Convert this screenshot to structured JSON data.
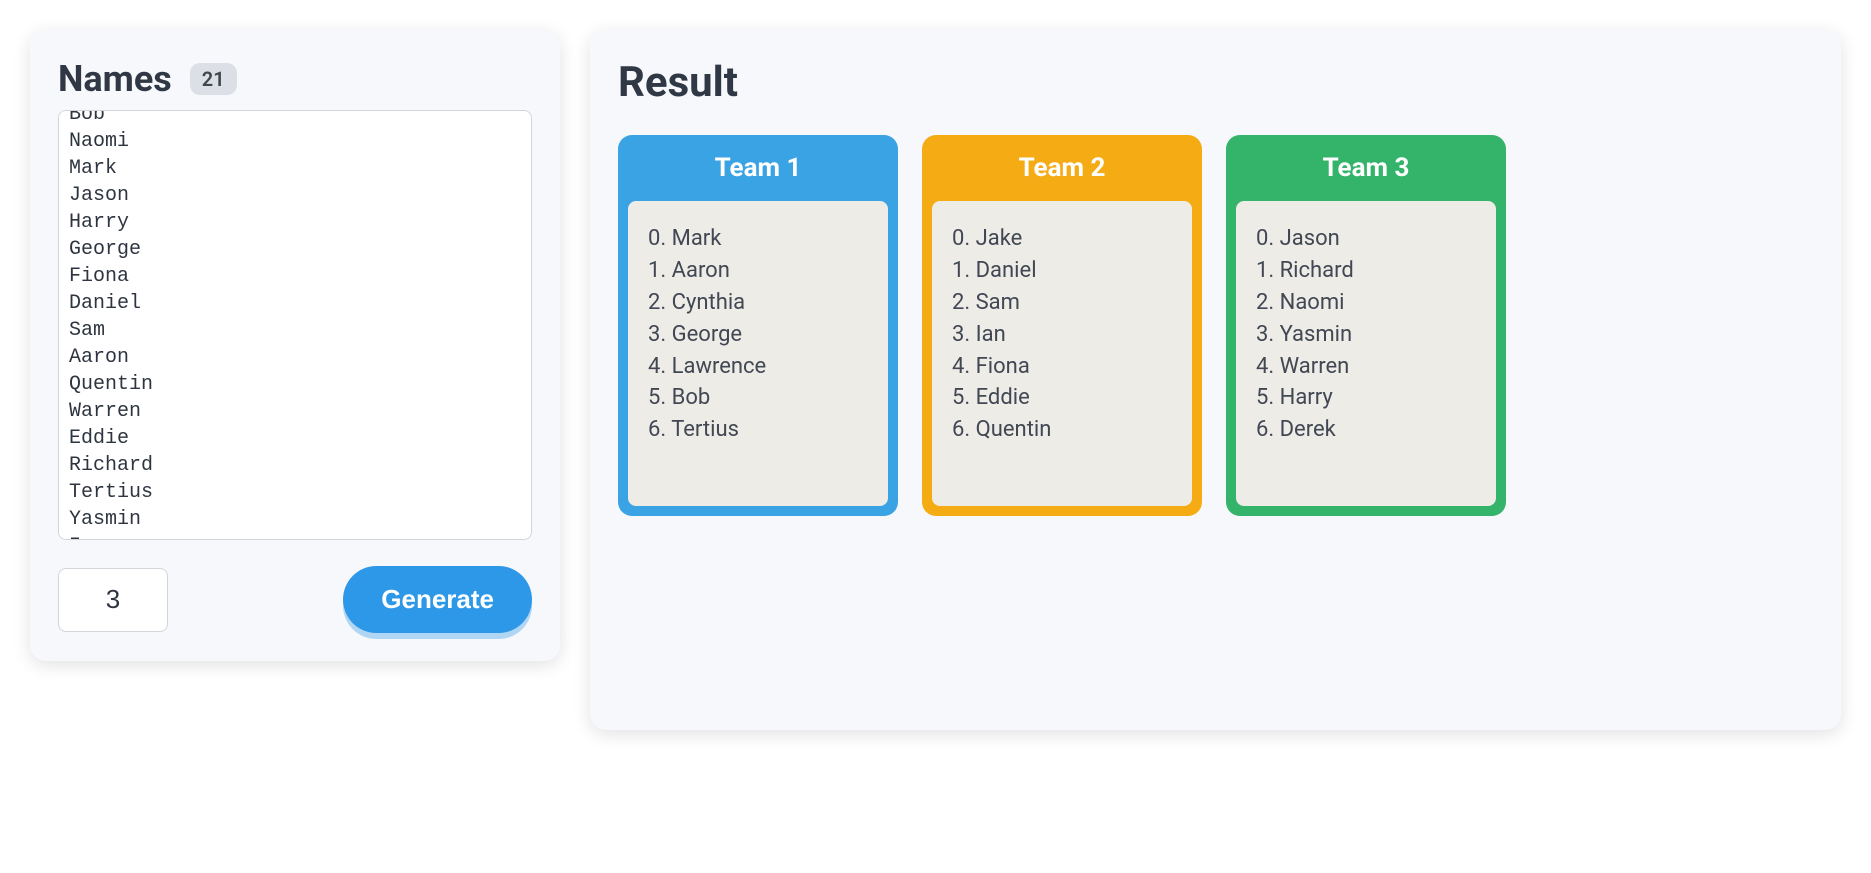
{
  "names": {
    "title": "Names",
    "count": "21",
    "textarea_value": "Bob\nNaomi\nMark\nJason\nHarry\nGeorge\nFiona\nDaniel\nSam\nAaron\nQuentin\nWarren\nEddie\nRichard\nTertius\nYasmin\nIan"
  },
  "controls": {
    "team_count_value": "3",
    "generate_label": "Generate"
  },
  "result": {
    "title": "Result",
    "teams": [
      {
        "name": "Team 1",
        "color_class": "team-blue",
        "members": [
          "Mark",
          "Aaron",
          "Cynthia",
          "George",
          "Lawrence",
          "Bob",
          "Tertius"
        ]
      },
      {
        "name": "Team 2",
        "color_class": "team-orange",
        "members": [
          "Jake",
          "Daniel",
          "Sam",
          "Ian",
          "Fiona",
          "Eddie",
          "Quentin"
        ]
      },
      {
        "name": "Team 3",
        "color_class": "team-green",
        "members": [
          "Jason",
          "Richard",
          "Naomi",
          "Yasmin",
          "Warren",
          "Harry",
          "Derek"
        ]
      }
    ]
  }
}
